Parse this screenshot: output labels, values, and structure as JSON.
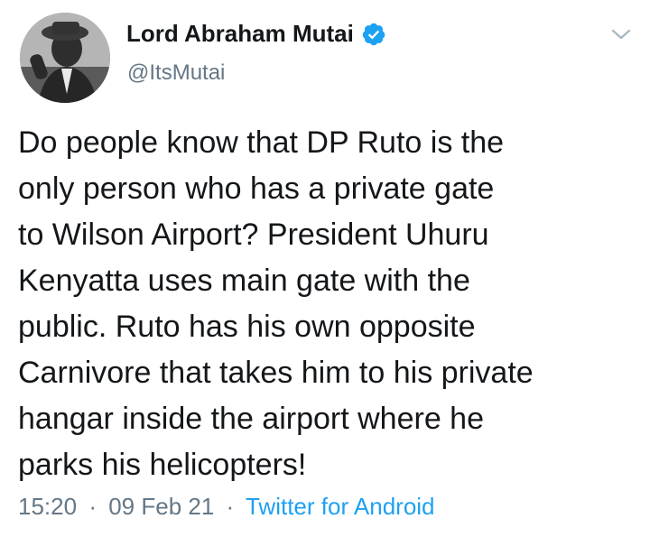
{
  "author": {
    "name": "Lord Abraham Mutai",
    "handle": "@ItsMutai",
    "verified": true
  },
  "tweet": {
    "lines": [
      "Do people know that DP Ruto is the",
      "only person who has a private gate",
      "to Wilson Airport? President Uhuru",
      "Kenyatta uses main gate with the",
      "public. Ruto has his own opposite",
      "Carnivore that takes him to his private",
      "hangar inside the airport where he",
      "parks his helicopters!"
    ]
  },
  "meta": {
    "time": "15:20",
    "separator": "·",
    "date": "09 Feb 21",
    "source": "Twitter for Android"
  },
  "icons": {
    "verified": "verified-badge-icon",
    "menu": "chevron-down-icon"
  },
  "colors": {
    "text": "#14171a",
    "secondary": "#657786",
    "accent": "#1da1f2"
  }
}
